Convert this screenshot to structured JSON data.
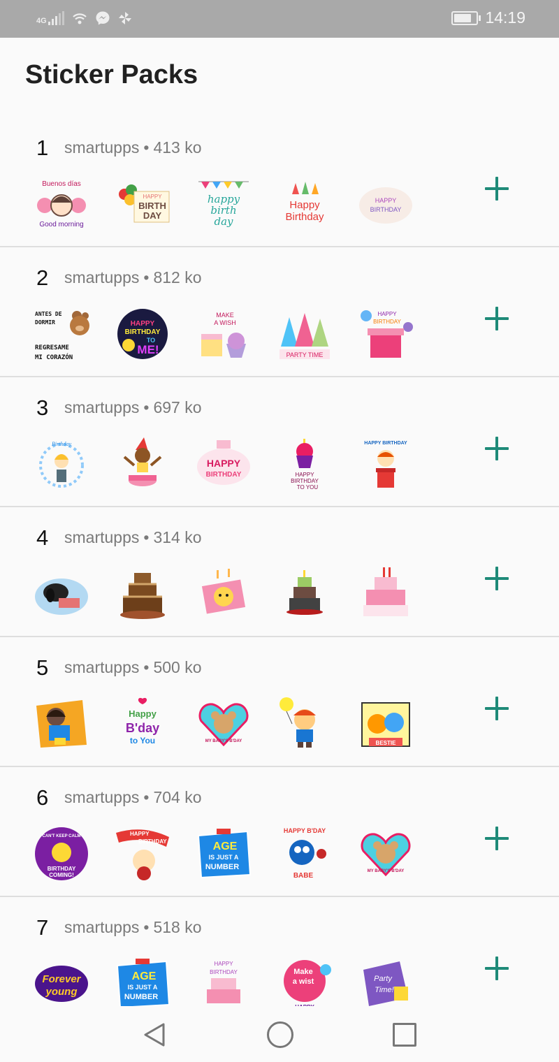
{
  "status_bar": {
    "network": "4G",
    "time": "14:19",
    "icons": [
      "signal-icon",
      "wifi-icon",
      "messenger-icon",
      "pinwheel-icon",
      "battery-icon"
    ]
  },
  "page_title": "Sticker Packs",
  "colors": {
    "accent": "#1e8a78",
    "status_bar": "#a9a9a9",
    "background": "#fafafa"
  },
  "packs": [
    {
      "number": "1",
      "publisher": "smartupps",
      "separator": "•",
      "size": "413 ko",
      "stickers": [
        {
          "texts": [
            "Buenos días",
            "Good morning"
          ]
        },
        {
          "texts": [
            "HAPPY",
            "BIRTH",
            "DAY"
          ]
        },
        {
          "texts": [
            "happy",
            "birth",
            "day"
          ]
        },
        {
          "texts": [
            "Happy",
            "Birthday"
          ]
        },
        {
          "texts": [
            "HAPPY",
            "BIRTHDAY"
          ]
        }
      ]
    },
    {
      "number": "2",
      "publisher": "smartupps",
      "separator": "•",
      "size": "812 ko",
      "stickers": [
        {
          "texts": [
            "ANTES DE",
            "DORMIR",
            "REGRESAME",
            "MI CORAZÓN"
          ]
        },
        {
          "texts": [
            "HAPPY",
            "BIRTHDAY",
            "TO",
            "ME!"
          ]
        },
        {
          "texts": [
            "MAKE",
            "A WISH"
          ]
        },
        {
          "texts": [
            "PARTY TIME"
          ]
        },
        {
          "texts": [
            "HAPPY",
            "BIRTHDAY"
          ]
        }
      ]
    },
    {
      "number": "3",
      "publisher": "smartupps",
      "separator": "•",
      "size": "697 ko",
      "stickers": [
        {
          "texts": [
            "Birthday"
          ]
        },
        {
          "texts": []
        },
        {
          "texts": [
            "HAPPY",
            "BIRTHDAY"
          ]
        },
        {
          "texts": [
            "HAPPY",
            "BIRTHDAY",
            "TO YOU"
          ]
        },
        {
          "texts": [
            "HAPPY BIRTHDAY"
          ]
        }
      ]
    },
    {
      "number": "4",
      "publisher": "smartupps",
      "separator": "•",
      "size": "314 ko",
      "stickers": [
        {
          "texts": []
        },
        {
          "texts": []
        },
        {
          "texts": []
        },
        {
          "texts": []
        },
        {
          "texts": []
        }
      ]
    },
    {
      "number": "5",
      "publisher": "smartupps",
      "separator": "•",
      "size": "500 ko",
      "stickers": [
        {
          "texts": []
        },
        {
          "texts": [
            "Happy",
            "B'day",
            "to You"
          ]
        },
        {
          "texts": [
            "MY BABY'S B'DAY"
          ]
        },
        {
          "texts": []
        },
        {
          "texts": [
            "BESTIE"
          ]
        }
      ]
    },
    {
      "number": "6",
      "publisher": "smartupps",
      "separator": "•",
      "size": "704 ko",
      "stickers": [
        {
          "texts": [
            "CAN'T KEEP CALM",
            "BIRTHDAY",
            "COMING!"
          ]
        },
        {
          "texts": [
            "HAPPY",
            "BIRTHDAY"
          ]
        },
        {
          "texts": [
            "AGE",
            "IS JUST A",
            "NUMBER"
          ]
        },
        {
          "texts": [
            "HAPPY B'DAY",
            "BABE"
          ]
        },
        {
          "texts": [
            "MY BABY'S B'DAY"
          ]
        }
      ]
    },
    {
      "number": "7",
      "publisher": "smartupps",
      "separator": "•",
      "size": "518 ko",
      "stickers": [
        {
          "texts": [
            "Forever",
            "young"
          ]
        },
        {
          "texts": [
            "AGE",
            "IS JUST A",
            "NUMBER"
          ]
        },
        {
          "texts": [
            "HAPPY",
            "BIRTHDAY"
          ]
        },
        {
          "texts": [
            "Make",
            "a wist",
            "HAPPY"
          ]
        },
        {
          "texts": [
            "Party",
            "Time!"
          ]
        }
      ]
    }
  ],
  "nav_bar": {
    "icons": [
      "back-icon",
      "home-icon",
      "recents-icon"
    ]
  }
}
